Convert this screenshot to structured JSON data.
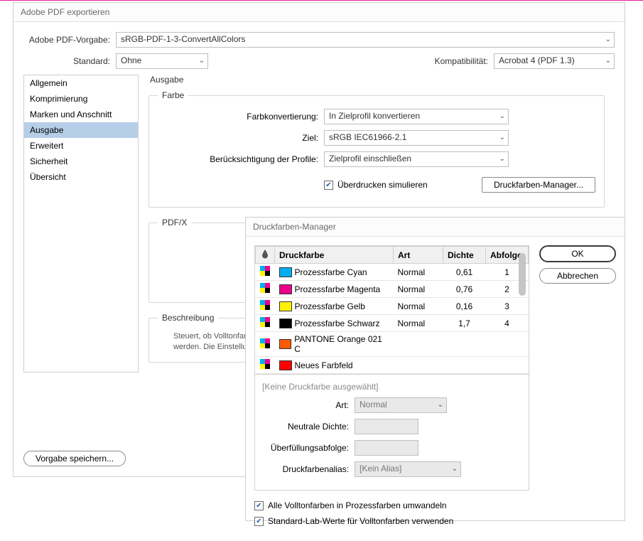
{
  "main": {
    "title": "Adobe PDF exportieren",
    "preset_label": "Adobe PDF-Vorgabe:",
    "preset_value": "sRGB-PDF-1-3-ConvertAllColors",
    "standard_label": "Standard:",
    "standard_value": "Ohne",
    "compat_label": "Kompatibilität:",
    "compat_value": "Acrobat 4 (PDF 1.3)",
    "sidebar": [
      "Allgemein",
      "Komprimierung",
      "Marken und Anschnitt",
      "Ausgabe",
      "Erweitert",
      "Sicherheit",
      "Übersicht"
    ],
    "sidebar_selected": 3,
    "panel_title": "Ausgabe",
    "color_legend": "Farbe",
    "rows": {
      "conv_label": "Farbkonvertierung:",
      "conv_value": "In Zielprofil konvertieren",
      "dest_label": "Ziel:",
      "dest_value": "sRGB IEC61966-2.1",
      "profile_label": "Berücksichtigung der Profile:",
      "profile_value": "Zielprofil einschließen"
    },
    "overprint_label": "Überdrucken simulieren",
    "ink_manager_btn": "Druckfarben-Manager...",
    "pdfx_legend": "PDF/X",
    "desc_legend": "Beschreibung",
    "desc_text": "Steuert, ob Volltonfarben in Prozessfarben umgewandelt werden und ob alle Druckfarbeneinstellungen verwendet werden. Die Einstellungen wirken sich nicht darauf aus, wie die P",
    "save_preset_btn": "Vorgabe speichern..."
  },
  "ink": {
    "title": "Druckfarben-Manager",
    "ok": "OK",
    "cancel": "Abbrechen",
    "headers": {
      "icon": "",
      "ink": "Druckfarbe",
      "type": "Art",
      "density": "Dichte",
      "seq": "Abfolge"
    },
    "rows": [
      {
        "color": "#00aeef",
        "name": "Prozessfarbe Cyan",
        "type": "Normal",
        "density": "0,61",
        "seq": "1"
      },
      {
        "color": "#ec008c",
        "name": "Prozessfarbe Magenta",
        "type": "Normal",
        "density": "0,76",
        "seq": "2"
      },
      {
        "color": "#fff200",
        "name": "Prozessfarbe Gelb",
        "type": "Normal",
        "density": "0,16",
        "seq": "3"
      },
      {
        "color": "#000000",
        "name": "Prozessfarbe Schwarz",
        "type": "Normal",
        "density": "1,7",
        "seq": "4"
      },
      {
        "color": "#ff5a00",
        "name": "PANTONE Orange 021 C",
        "type": "",
        "density": "",
        "seq": ""
      },
      {
        "color": "#ff0000",
        "name": "Neues Farbfeld",
        "type": "",
        "density": "",
        "seq": ""
      }
    ],
    "noink": "[Keine Druckfarbe ausgewählt]",
    "type_label": "Art:",
    "type_value": "Normal",
    "nd_label": "Neutrale Dichte:",
    "trap_label": "Überfüllungsabfolge:",
    "alias_label": "Druckfarbenalias:",
    "alias_value": "[Kein Alias]",
    "cb1": "Alle Volltonfarben in Prozessfarben umwandeln",
    "cb2": "Standard-Lab-Werte für Volltonfarben verwenden"
  }
}
